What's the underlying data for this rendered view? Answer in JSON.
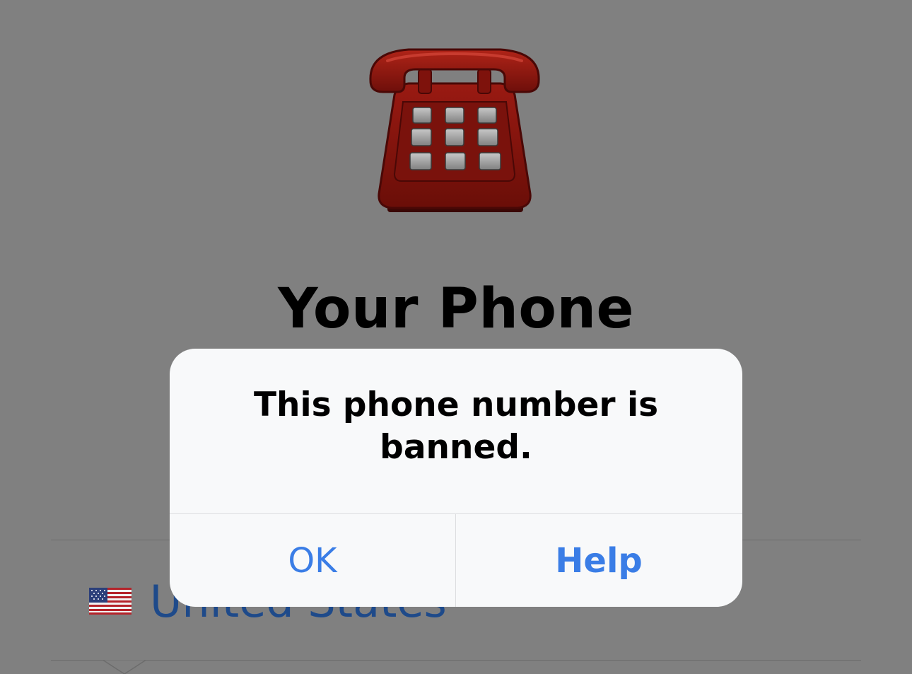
{
  "screen": {
    "title": "Your Phone",
    "country": {
      "name": "United States",
      "flag_icon": "us-flag-icon"
    },
    "illustration_icon": "red-telephone-icon"
  },
  "alert": {
    "message": "This phone number is banned.",
    "buttons": {
      "ok_label": "OK",
      "help_label": "Help"
    }
  },
  "colors": {
    "overlay_background": "#808080",
    "alert_background": "#f8f9fa",
    "button_blue": "#3a7de6",
    "country_text": "#1e4a8a"
  }
}
